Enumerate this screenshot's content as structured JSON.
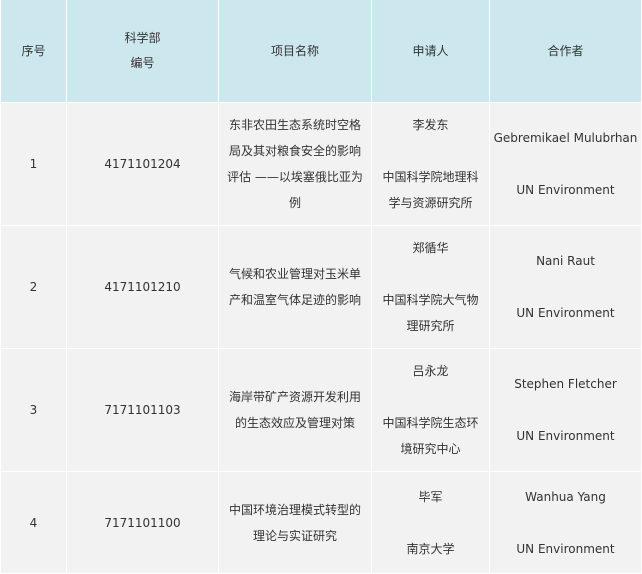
{
  "headers": {
    "seq": "序号",
    "most_line1": "科学部",
    "most_line2": "编号",
    "project": "项目名称",
    "applicant": "申请人",
    "partner": "合作者"
  },
  "rows": [
    {
      "seq": "1",
      "code": "4171101204",
      "title": "东非农田生态系统时空格局及其对粮食安全的影响评估 ——以埃塞俄比亚为例",
      "applicant": "李发东",
      "institution": "中国科学院地理科学与资源研究所",
      "partner": "Gebremikael Mulubrhan",
      "partner_org": "UN Environment"
    },
    {
      "seq": "2",
      "code": "4171101210",
      "title": "气候和农业管理对玉米单产和温室气体足迹的影响",
      "applicant": "郑循华",
      "institution": "中国科学院大气物理研究所",
      "partner": "Nani Raut",
      "partner_org": "UN Environment"
    },
    {
      "seq": "3",
      "code": "7171101103",
      "title": "海岸带矿产资源开发利用的生态效应及管理对策",
      "applicant": "吕永龙",
      "institution": "中国科学院生态环境研究中心",
      "partner": "Stephen Fletcher",
      "partner_org": "UN Environment"
    },
    {
      "seq": "4",
      "code": "7171101100",
      "title": "中国环境治理模式转型的理论与实证研究",
      "applicant": "毕军",
      "institution": "南京大学",
      "partner": "Wanhua Yang",
      "partner_org": "UN Environment"
    }
  ],
  "colors": {
    "header_bg": "#cde7ef",
    "row_bg": "#f2f2f2",
    "text": "#333333"
  }
}
